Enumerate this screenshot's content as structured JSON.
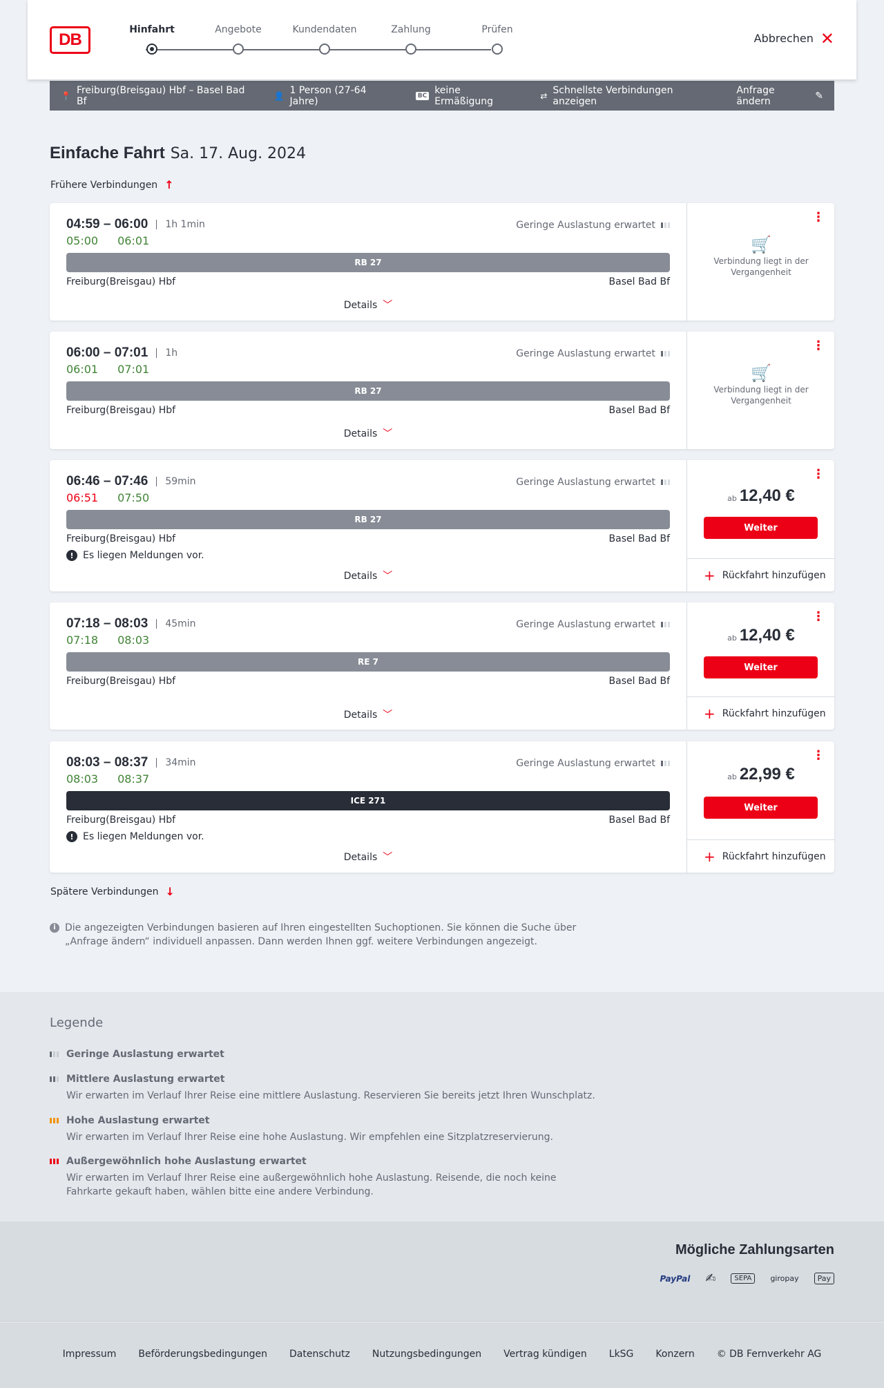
{
  "header": {
    "logo": "DB",
    "steps": [
      {
        "label": "Hinfahrt",
        "active": true
      },
      {
        "label": "Angebote",
        "active": false
      },
      {
        "label": "Kundendaten",
        "active": false
      },
      {
        "label": "Zahlung",
        "active": false
      },
      {
        "label": "Prüfen",
        "active": false
      }
    ],
    "cancel_label": "Abbrechen"
  },
  "summary": {
    "route": "Freiburg(Breisgau) Hbf – Basel Bad Bf",
    "persons": "1 Person (27-64 Jahre)",
    "bc_icon": "BC",
    "discount": "keine Ermäßigung",
    "fastest": "Schnellste Verbindungen anzeigen",
    "edit_label": "Anfrage ändern"
  },
  "page": {
    "title": "Einfache Fahrt",
    "date": "Sa. 17. Aug. 2024",
    "earlier": "Frühere Verbindungen",
    "later": "Spätere Verbindungen",
    "info": "Die angezeigten Verbindungen basieren auf Ihren eingestellten Suchoptionen. Sie können die Suche über „Anfrage ändern“ individuell anpassen. Dann werden Ihnen ggf. weitere Verbindungen angezeigt."
  },
  "connections": [
    {
      "times": "04:59 – 06:00",
      "duration": "1h 1min",
      "rt_dep": "05:00",
      "rt_arr": "06:01",
      "occupancy": "Geringe Auslastung erwartet",
      "train": "RB 27",
      "from": "Freiburg(Breisgau) Hbf",
      "to": "Basel Bad Bf",
      "details": "Details",
      "past": "Verbindung liegt in der Vergangenheit"
    },
    {
      "times": "06:00 – 07:01",
      "duration": "1h",
      "rt_dep": "06:01",
      "rt_arr": "07:01",
      "occupancy": "Geringe Auslastung erwartet",
      "train": "RB 27",
      "from": "Freiburg(Breisgau) Hbf",
      "to": "Basel Bad Bf",
      "details": "Details",
      "past": "Verbindung liegt in der Vergangenheit"
    },
    {
      "times": "06:46 – 07:46",
      "duration": "59min",
      "rt_dep": "06:51",
      "rt_arr": "07:50",
      "occupancy": "Geringe Auslastung erwartet",
      "train": "RB 27",
      "from": "Freiburg(Breisgau) Hbf",
      "to": "Basel Bad Bf",
      "message": "Es liegen Meldungen vor.",
      "details": "Details",
      "price_prefix": "ab",
      "price": "12,40 €",
      "button": "Weiter",
      "return": "Rückfahrt hinzufügen"
    },
    {
      "times": "07:18 – 08:03",
      "duration": "45min",
      "rt_dep": "07:18",
      "rt_arr": "08:03",
      "occupancy": "Geringe Auslastung erwartet",
      "train": "RE 7",
      "from": "Freiburg(Breisgau) Hbf",
      "to": "Basel Bad Bf",
      "details": "Details",
      "price_prefix": "ab",
      "price": "12,40 €",
      "button": "Weiter",
      "return": "Rückfahrt hinzufügen"
    },
    {
      "times": "08:03 – 08:37",
      "duration": "34min",
      "rt_dep": "08:03",
      "rt_arr": "08:37",
      "occupancy": "Geringe Auslastung erwartet",
      "train": "ICE 271",
      "from": "Freiburg(Breisgau) Hbf",
      "to": "Basel Bad Bf",
      "message": "Es liegen Meldungen vor.",
      "details": "Details",
      "price_prefix": "ab",
      "price": "22,99 €",
      "button": "Weiter",
      "return": "Rückfahrt hinzufügen"
    }
  ],
  "legend": {
    "title": "Legende",
    "items": [
      {
        "title": "Geringe Auslastung erwartet",
        "desc": ""
      },
      {
        "title": "Mittlere Auslastung erwartet",
        "desc": "Wir erwarten im Verlauf Ihrer Reise eine mittlere Auslastung. Reservieren Sie bereits jetzt Ihren Wunschplatz."
      },
      {
        "title": "Hohe Auslastung erwartet",
        "desc": "Wir erwarten im Verlauf Ihrer Reise eine hohe Auslastung. Wir empfehlen eine Sitzplatzreservierung."
      },
      {
        "title": "Außergewöhnlich hohe Auslastung erwartet",
        "desc": "Wir erwarten im Verlauf Ihrer Reise eine außergewöhnlich hohe Auslastung. Reisende, die noch keine Fahrkarte gekauft haben, wählen bitte eine andere Verbindung."
      }
    ]
  },
  "payments": {
    "title": "Mögliche Zahlungsarten",
    "paypal": "PayPal",
    "sepa": "SEPA",
    "giropay": "giropay",
    "applepay": "Pay"
  },
  "footer": {
    "links": [
      "Impressum",
      "Beförderungsbedingungen",
      "Datenschutz",
      "Nutzungsbedingungen",
      "Vertrag kündigen",
      "LkSG",
      "Konzern",
      "© DB Fernverkehr AG"
    ]
  },
  "colors": {
    "brand": "#ec0016",
    "ontime": "#408335",
    "summary_bg": "#646973",
    "ice": "#282d37"
  }
}
